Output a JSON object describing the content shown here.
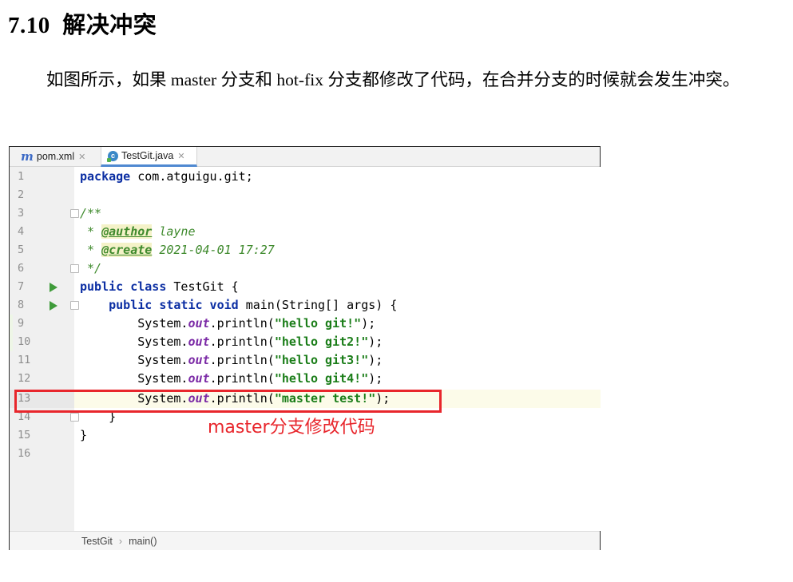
{
  "section": {
    "number": "7.10",
    "title": "解决冲突"
  },
  "paragraph": "如图所示，如果 master 分支和 hot-fix 分支都修改了代码，在合并分支的时候就会发生冲突。",
  "ide": {
    "tabs": [
      {
        "label": "pom.xml",
        "icon": "maven-icon"
      },
      {
        "label": "TestGit.java",
        "icon": "java-class-icon",
        "active": true
      }
    ],
    "lines": [
      {
        "n": "1",
        "text": "package com.atguigu.git;"
      },
      {
        "n": "2",
        "text": ""
      },
      {
        "n": "3",
        "text": "/**"
      },
      {
        "n": "4",
        "text": " * @author layne"
      },
      {
        "n": "5",
        "text": " * @create 2021-04-01 17:27"
      },
      {
        "n": "6",
        "text": " */"
      },
      {
        "n": "7",
        "text": "public class TestGit {"
      },
      {
        "n": "8",
        "text": "    public static void main(String[] args) {"
      },
      {
        "n": "9",
        "text": "        System.out.println(\"hello git!\");"
      },
      {
        "n": "10",
        "text": "        System.out.println(\"hello git2!\");"
      },
      {
        "n": "11",
        "text": "        System.out.println(\"hello git3!\");"
      },
      {
        "n": "12",
        "text": "        System.out.println(\"hello git4!\");"
      },
      {
        "n": "13",
        "text": "        System.out.println(\"master test!\");"
      },
      {
        "n": "14",
        "text": "    }"
      },
      {
        "n": "15",
        "text": "}"
      },
      {
        "n": "16",
        "text": ""
      }
    ],
    "annotation": "master分支修改代码",
    "breadcrumb": [
      "TestGit",
      "main()"
    ],
    "colors": {
      "highlight_border": "#e8262c",
      "keyword": "#0b2ea3",
      "string": "#1a7d18"
    }
  }
}
